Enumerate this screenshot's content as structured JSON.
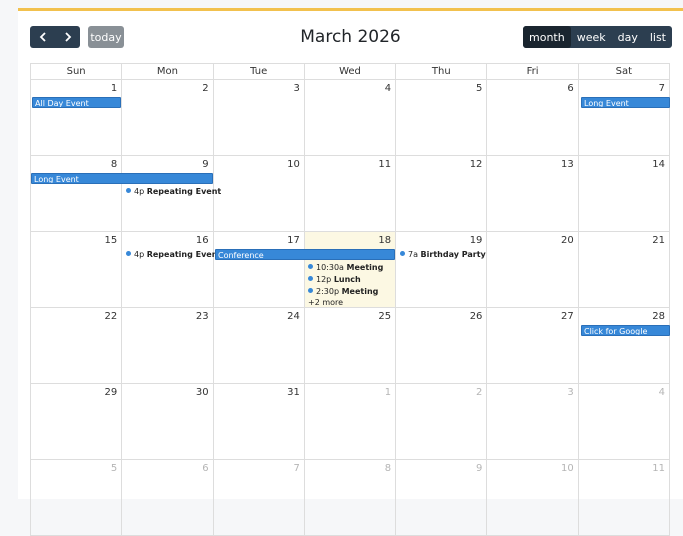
{
  "toolbar": {
    "prev_icon": "chevron-left",
    "next_icon": "chevron-right",
    "today_label": "today",
    "title": "March 2026",
    "views": [
      "month",
      "week",
      "day",
      "list"
    ],
    "active_view": "month"
  },
  "day_headers": [
    "Sun",
    "Mon",
    "Tue",
    "Wed",
    "Thu",
    "Fri",
    "Sat"
  ],
  "weeks": [
    [
      "1",
      "2",
      "3",
      "4",
      "5",
      "6",
      "7"
    ],
    [
      "8",
      "9",
      "10",
      "11",
      "12",
      "13",
      "14"
    ],
    [
      "15",
      "16",
      "17",
      "18",
      "19",
      "20",
      "21"
    ],
    [
      "22",
      "23",
      "24",
      "25",
      "26",
      "27",
      "28"
    ],
    [
      "29",
      "30",
      "31",
      "1",
      "2",
      "3",
      "4"
    ],
    [
      "5",
      "6",
      "7",
      "8",
      "9",
      "10",
      "11"
    ]
  ],
  "events": {
    "all_day_event": "All Day Event",
    "long_event_1": "Long Event",
    "long_event_2": "Long Event",
    "repeating_1": {
      "time": "4p",
      "title": "Repeating Event"
    },
    "repeating_2": {
      "time": "4p",
      "title": "Repeating Event"
    },
    "conference": "Conference",
    "meeting_1": {
      "time": "10:30a",
      "title": "Meeting"
    },
    "lunch": {
      "time": "12p",
      "title": "Lunch"
    },
    "meeting_2": {
      "time": "2:30p",
      "title": "Meeting"
    },
    "more_link": "+2 more",
    "birthday": {
      "time": "7a",
      "title": "Birthday Party"
    },
    "google": "Click for Google"
  },
  "colors": {
    "accent_top": "#f2c14e",
    "event_blue": "#3788d8",
    "button_dark": "#2c3e50",
    "today_bg": "#fcf8e3"
  }
}
